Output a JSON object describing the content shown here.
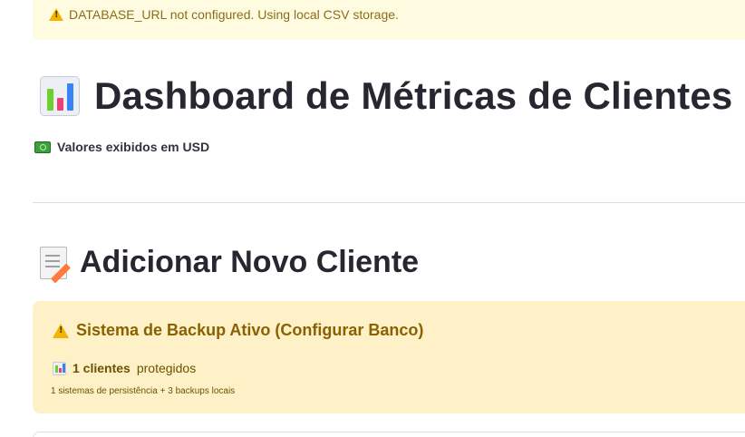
{
  "top_alert": {
    "icon": "warning-icon",
    "text": "DATABASE_URL not configured. Using local CSV storage."
  },
  "header": {
    "title_icon": "bar-chart-icon",
    "title": "Dashboard de Métricas de Clientes",
    "currency_icon": "dollar-banknote-icon",
    "currency_text": "Valores exibidos em USD"
  },
  "section": {
    "icon": "memo-icon",
    "title": "Adicionar Novo Cliente"
  },
  "backup": {
    "title_icon": "warning-icon",
    "title": "Sistema de Backup Ativo (Configurar Banco)",
    "count_icon": "bar-chart-icon",
    "count_strong": "1 clientes",
    "count_rest": "protegidos",
    "details": "1 sistemas de persistência + 3 backups locais"
  },
  "colors": {
    "alert_bg": "#fffbe0",
    "backup_bg": "#fff1c7",
    "warning_text": "#8a6100",
    "title_text": "#262730"
  }
}
